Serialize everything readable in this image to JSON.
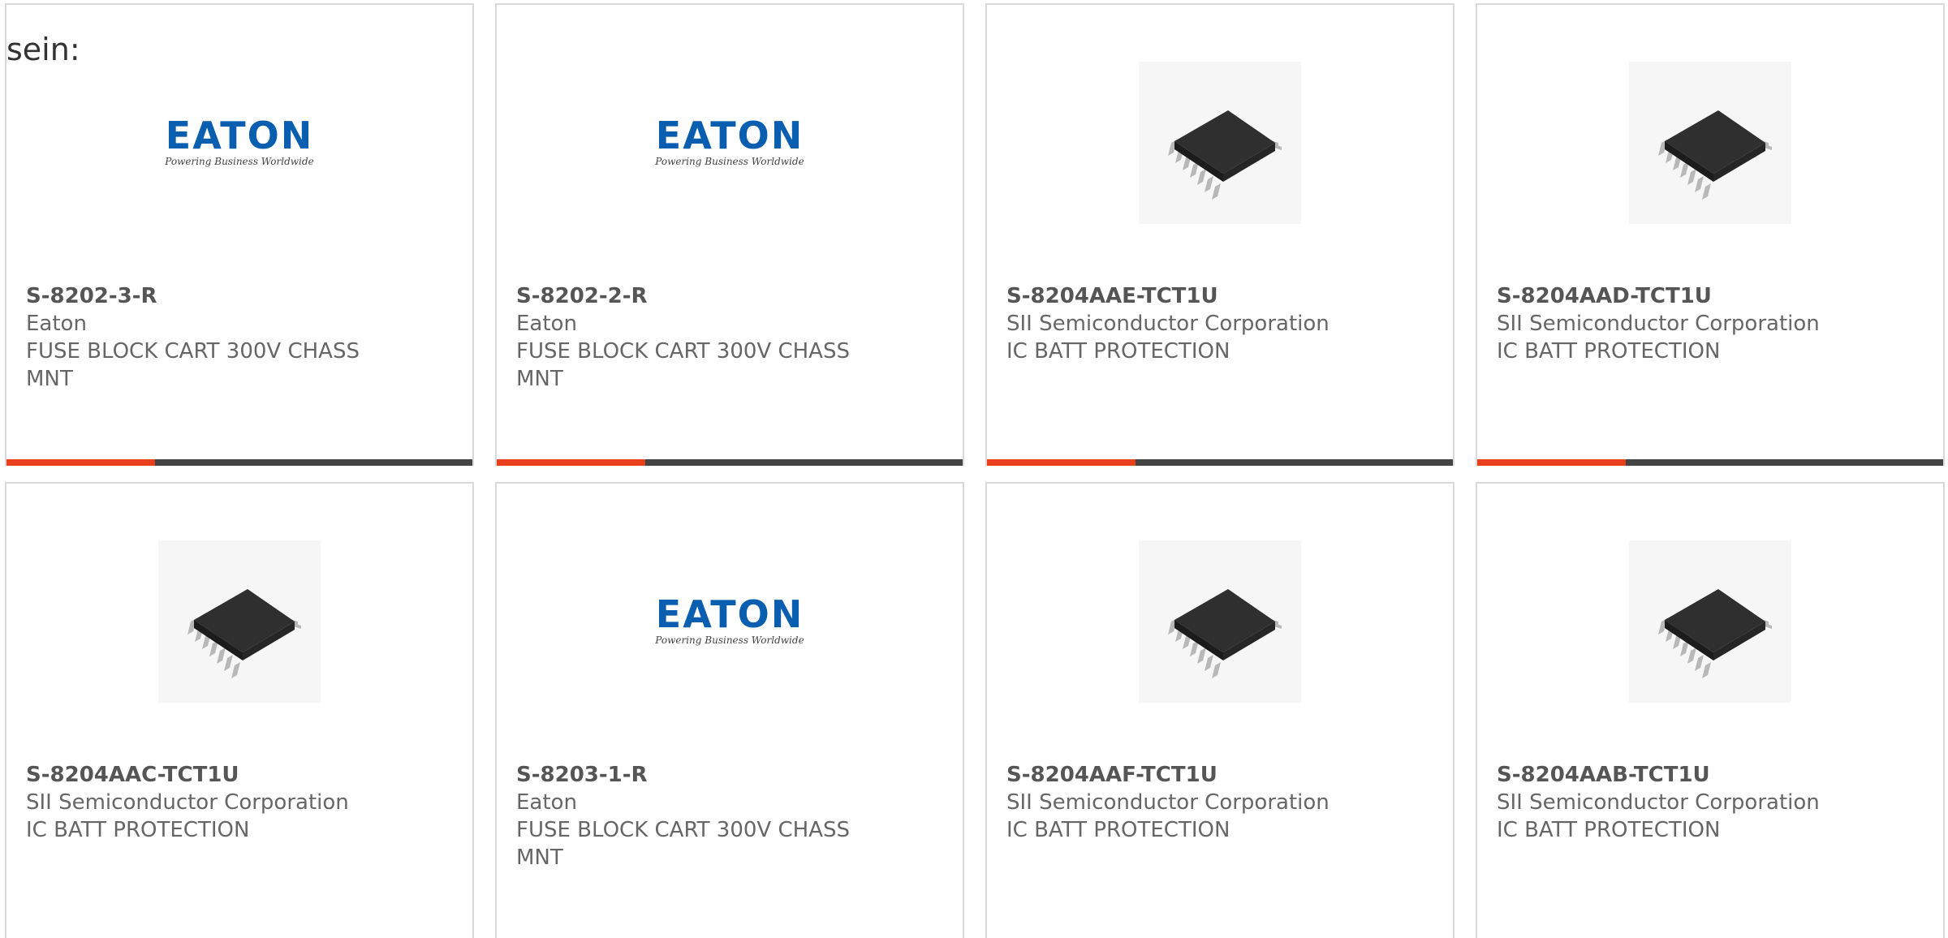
{
  "intro_text": "sein:",
  "logo": {
    "word": "EATON",
    "tagline": "Powering Business Worldwide"
  },
  "colors": {
    "accent": "#e8401c",
    "bar": "#444444",
    "eaton_blue": "#0a5eb0",
    "chip": "#2f2f2f"
  },
  "products": [
    {
      "part": "S-8202-3-R",
      "manufacturer": "Eaton",
      "description": "FUSE BLOCK CART 300V CHASS MNT",
      "image": "eaton-logo"
    },
    {
      "part": "S-8202-2-R",
      "manufacturer": "Eaton",
      "description": "FUSE BLOCK CART 300V CHASS MNT",
      "image": "eaton-logo"
    },
    {
      "part": "S-8204AAE-TCT1U",
      "manufacturer": "SII Semiconductor Corporation",
      "description": "IC BATT PROTECTION",
      "image": "ic-chip"
    },
    {
      "part": "S-8204AAD-TCT1U",
      "manufacturer": "SII Semiconductor Corporation",
      "description": "IC BATT PROTECTION",
      "image": "ic-chip"
    },
    {
      "part": "S-8204AAC-TCT1U",
      "manufacturer": "SII Semiconductor Corporation",
      "description": "IC BATT PROTECTION",
      "image": "ic-chip"
    },
    {
      "part": "S-8203-1-R",
      "manufacturer": "Eaton",
      "description": "FUSE BLOCK CART 300V CHASS MNT",
      "image": "eaton-logo"
    },
    {
      "part": "S-8204AAF-TCT1U",
      "manufacturer": "SII Semiconductor Corporation",
      "description": "IC BATT PROTECTION",
      "image": "ic-chip"
    },
    {
      "part": "S-8204AAB-TCT1U",
      "manufacturer": "SII Semiconductor Corporation",
      "description": "IC BATT PROTECTION",
      "image": "ic-chip"
    }
  ]
}
